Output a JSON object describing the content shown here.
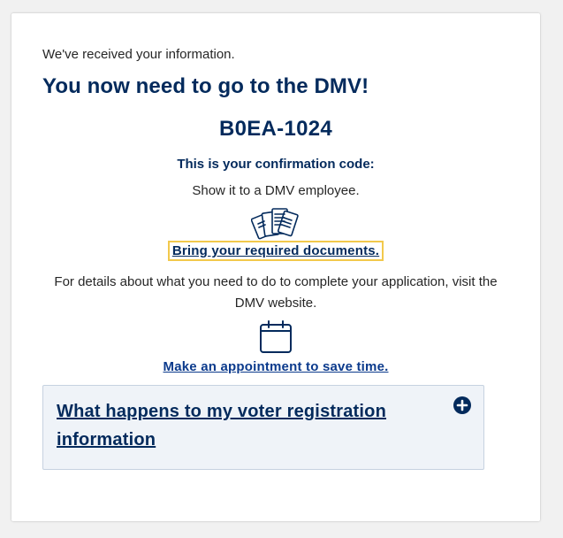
{
  "confirmation": {
    "intro_text": "We've received your information.",
    "headline": "You now need to go to the DMV!",
    "code": "B0EA-1024",
    "code_label": "This is your confirmation code:",
    "show_text": "Show it to a DMV employee.",
    "documents_link": "Bring your required documents.",
    "details_text": "For details about what you need to do to complete your application, visit the DMV website.",
    "appointment_link": "Make an appointment to save time."
  },
  "accordion": {
    "title": "What happens to my voter registration information",
    "expand_icon": "plus-circle-icon"
  },
  "icons": {
    "documents": "documents-icon",
    "calendar": "calendar-icon"
  },
  "colors": {
    "heading_navy": "#032a5c",
    "link_blue": "#0b3a8c",
    "focus_outline": "#f2c94c",
    "accordion_bg": "#eff3f8"
  }
}
